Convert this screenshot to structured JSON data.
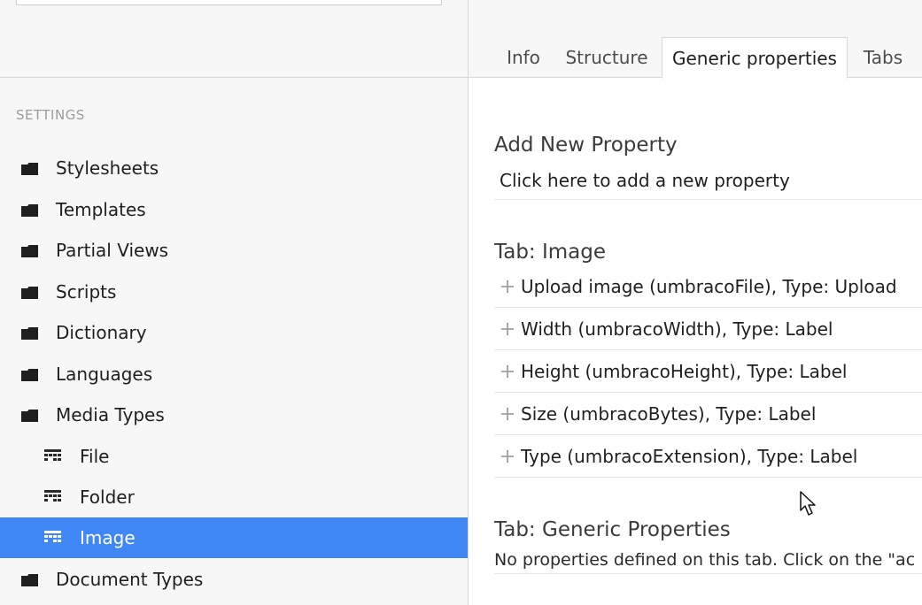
{
  "sidebar": {
    "section_title": "SETTINGS",
    "items": [
      {
        "label": "Stylesheets",
        "icon": "folder-icon"
      },
      {
        "label": "Templates",
        "icon": "folder-icon"
      },
      {
        "label": "Partial Views",
        "icon": "folder-icon"
      },
      {
        "label": "Scripts",
        "icon": "folder-icon"
      },
      {
        "label": "Dictionary",
        "icon": "folder-icon"
      },
      {
        "label": "Languages",
        "icon": "folder-icon"
      },
      {
        "label": "Media Types",
        "icon": "folder-icon"
      },
      {
        "label": "File",
        "icon": "media-type-icon"
      },
      {
        "label": "Folder",
        "icon": "media-type-icon"
      },
      {
        "label": "Image",
        "icon": "media-type-icon",
        "selected": true
      },
      {
        "label": "Document Types",
        "icon": "folder-icon"
      }
    ]
  },
  "tabs": [
    {
      "label": "Info"
    },
    {
      "label": "Structure"
    },
    {
      "label": "Generic properties",
      "active": true
    },
    {
      "label": "Tabs"
    }
  ],
  "main": {
    "add_property": {
      "heading": "Add New Property",
      "link": "Click here to add a new property"
    },
    "tab_image": {
      "heading": "Tab: Image",
      "properties": [
        "Upload image (umbracoFile), Type: Upload",
        "Width (umbracoWidth), Type: Label",
        "Height (umbracoHeight), Type: Label",
        "Size (umbracoBytes), Type: Label",
        "Type (umbracoExtension), Type: Label"
      ]
    },
    "tab_generic": {
      "heading": "Tab: Generic Properties",
      "empty_text": "No properties defined on this tab. Click on the \"ac"
    }
  },
  "colors": {
    "selected": "#3f87f5",
    "sidebar_bg": "#f7f7f7"
  }
}
